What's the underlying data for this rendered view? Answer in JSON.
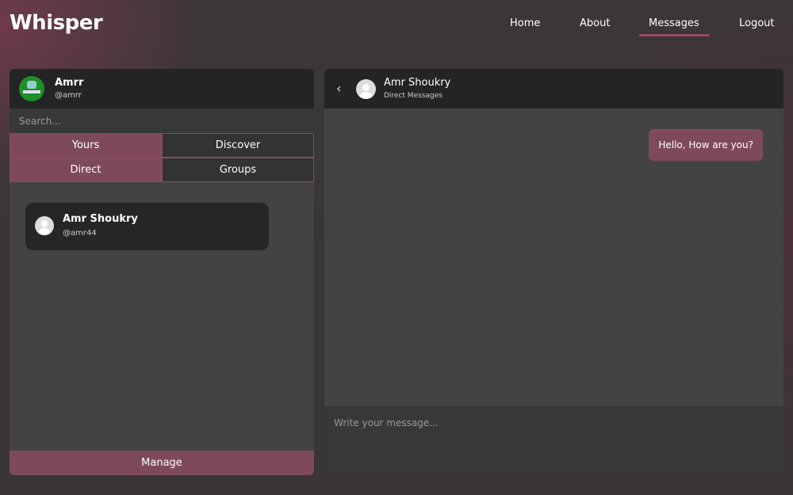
{
  "app": {
    "title": "Whisper"
  },
  "nav": {
    "items": [
      {
        "label": "Home"
      },
      {
        "label": "About"
      },
      {
        "label": "Messages",
        "active": true
      },
      {
        "label": "Logout"
      }
    ],
    "accent": "#9c4a64"
  },
  "sidebar": {
    "user": {
      "name": "Amrr",
      "handle": "@amrr"
    },
    "search_placeholder": "Search...",
    "tabs": [
      {
        "label": "Yours",
        "active": true
      },
      {
        "label": "Discover",
        "active": false
      },
      {
        "label": "Direct",
        "active": true
      },
      {
        "label": "Groups",
        "active": false
      }
    ],
    "contacts": [
      {
        "name": "Amr Shoukry",
        "handle": "@amr44"
      }
    ],
    "manage_label": "Manage"
  },
  "chat": {
    "back_icon": "chevron-left-icon",
    "contact": {
      "name": "Amr Shoukry",
      "subtitle": "Direct Messages"
    },
    "messages": [
      {
        "text": "Hello, How are you?",
        "outgoing": true
      }
    ],
    "compose_placeholder": "Write your message..."
  }
}
